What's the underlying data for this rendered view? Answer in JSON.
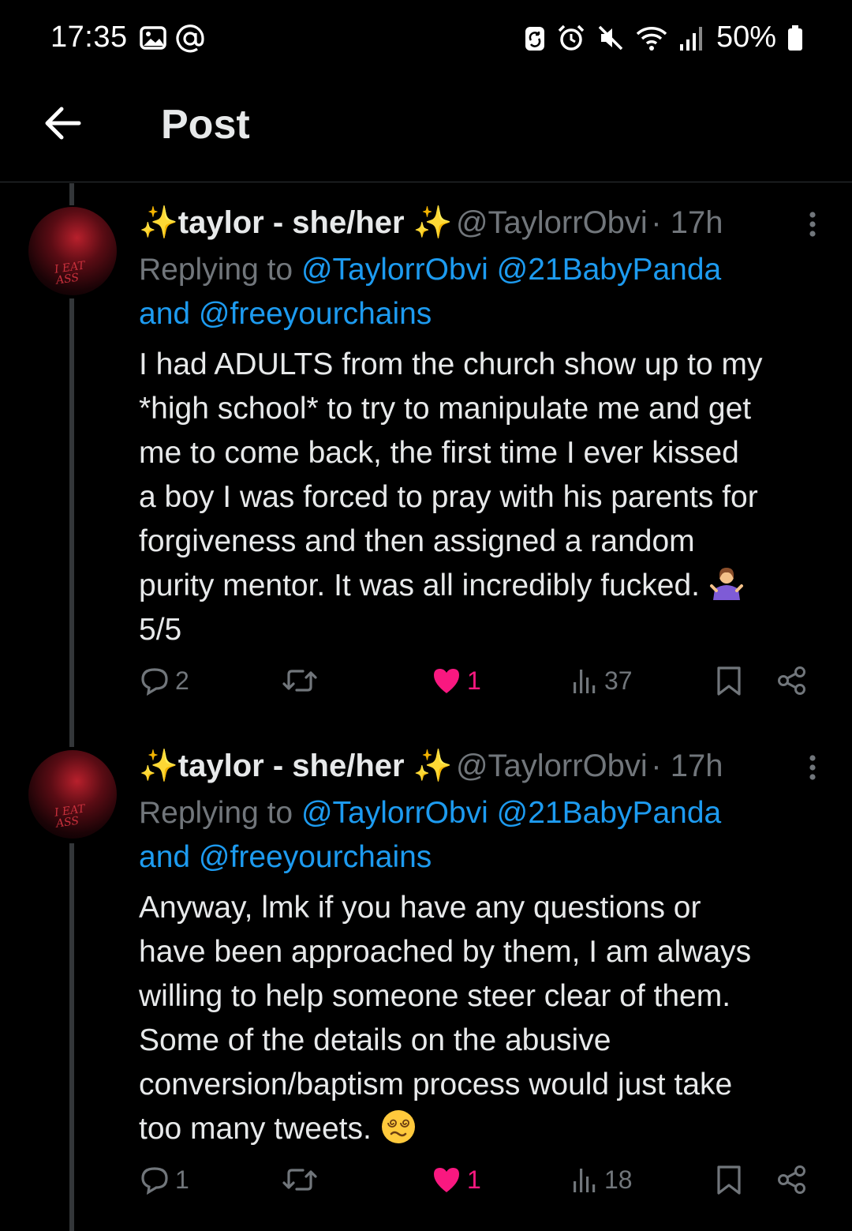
{
  "status_bar": {
    "time": "17:35",
    "left_icons": [
      "gallery-icon",
      "at-icon"
    ],
    "right_icons": [
      "sync-icon",
      "alarm-icon",
      "mute-icon",
      "wifi-icon",
      "signal-icon"
    ],
    "battery": "50%"
  },
  "header": {
    "back_icon": "arrow-left-icon",
    "title": "Post"
  },
  "tweets": [
    {
      "display_name": "✨taylor - she/her ✨",
      "handle": "@TaylorrObvi",
      "time": "· 17h",
      "replying_prefix": "Replying to ",
      "mention_1": "@TaylorrObvi",
      "mention_2": "@21BabyPanda",
      "and_text": "and ",
      "mention_3": "@freeyourchains",
      "body_lines": [
        "I had ADULTS from the church show up to my",
        "*high school* to try to manipulate me and get",
        "me to come back, the first time I ever kissed",
        "a boy I was forced to pray with his parents for",
        "forgiveness and then assigned a random",
        "purity mentor. It was all incredibly fucked.",
        "5/5"
      ],
      "emoji": "person-shrugging-emoji",
      "replies": "2",
      "likes": "1",
      "views": "37"
    },
    {
      "display_name": "✨taylor - she/her ✨",
      "handle": "@TaylorrObvi",
      "time": "· 17h",
      "replying_prefix": "Replying to ",
      "mention_1": "@TaylorrObvi",
      "mention_2": "@21BabyPanda",
      "and_text": "and ",
      "mention_3": "@freeyourchains",
      "body_lines": [
        "Anyway, lmk if you have any questions or",
        "have been approached by them, I am always",
        "willing to help someone steer clear of them.",
        "Some of the details on the abusive",
        "conversion/baptism process would just take",
        "too many tweets."
      ],
      "emoji": "face-with-spiral-eyes-emoji",
      "replies": "1",
      "likes": "1",
      "views": "18"
    }
  ],
  "colors": {
    "background": "#000000",
    "text": "#e7e9ea",
    "muted": "#71767b",
    "link": "#1d9bf0",
    "like": "#f91880"
  }
}
